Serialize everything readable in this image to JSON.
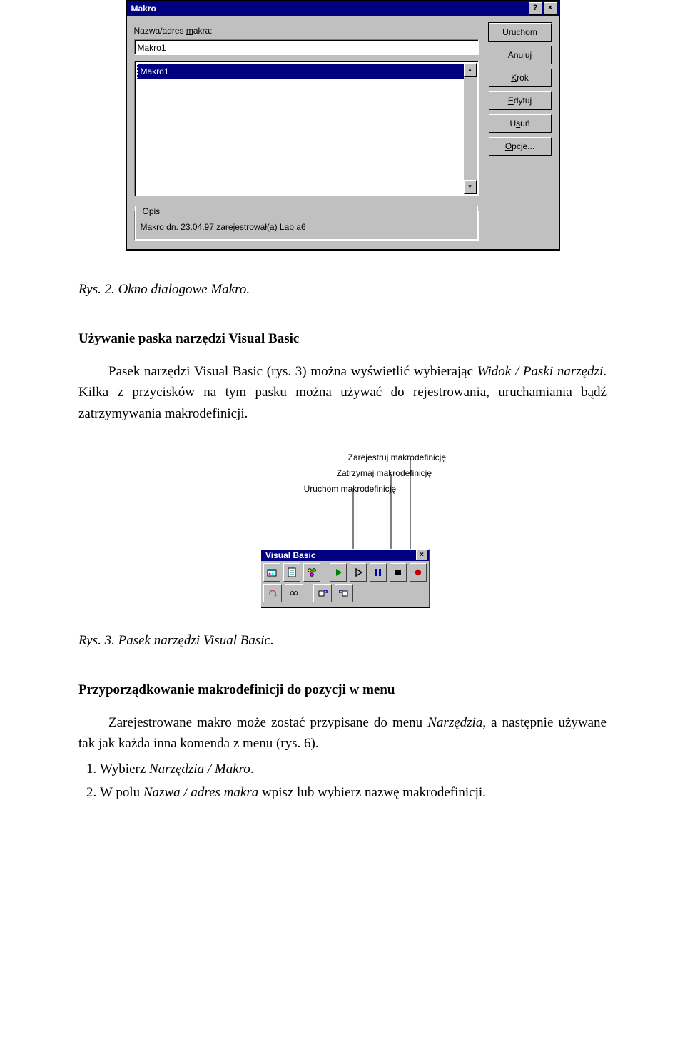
{
  "dialog": {
    "title": "Makro",
    "help_btn": "?",
    "close_btn": "×",
    "name_label_pre": "Nazwa/adres ",
    "name_label_u": "m",
    "name_label_post": "akra:",
    "name_value": "Makro1",
    "list_selected": "Makro1",
    "scroll_up": "▴",
    "scroll_down": "▾",
    "buttons": {
      "run_u": "U",
      "run_post": "ruchom",
      "cancel": "Anuluj",
      "step_u": "K",
      "step_post": "rok",
      "edit_u": "E",
      "edit_post": "dytuj",
      "delete_pre": "U",
      "delete_u": "s",
      "delete_post": "uń",
      "options_u": "O",
      "options_post": "pcje..."
    },
    "group": {
      "legend": "Opis",
      "text": "Makro dn. 23.04.97 zarejestrował(a) Lab a6"
    }
  },
  "caption1": "Rys. 2. Okno dialogowe Makro.",
  "section1_title": "Używanie paska narzędzi Visual Basic",
  "section1_text_a": "Pasek narzędzi Visual Basic (rys. 3) można wyświetlić wybierając ",
  "section1_term": "Widok / Paski narzędzi",
  "section1_text_b": ". Kilka z przycisków na tym pasku można używać do rejestrowania, uruchamiania bądź zatrzymywania makrodefinicji.",
  "fig3": {
    "ann1": "Zarejestruj makrodefinicję",
    "ann2": "Zatrzymaj makrodefinicję",
    "ann3": "Uruchom makrodefinicję",
    "toolbar_title": "Visual Basic",
    "close": "×"
  },
  "caption2": "Rys. 3. Pasek narzędzi Visual Basic.",
  "section2_title": "Przyporządkowanie makrodefinicji do pozycji w menu",
  "section2_text_a": "Zarejestrowane makro może zostać przypisane do menu ",
  "section2_term_a": "Narzędzia",
  "section2_text_b": ", a następnie używane tak jak każda inna komenda z menu (rys. 6).",
  "steps": {
    "s1_a": "Wybierz ",
    "s1_term": "Narzędzia / Makro",
    "s1_b": ".",
    "s2_a": "W polu ",
    "s2_term": "Nazwa / adres makra",
    "s2_b": " wpisz lub wybierz nazwę makrodefinicji."
  }
}
